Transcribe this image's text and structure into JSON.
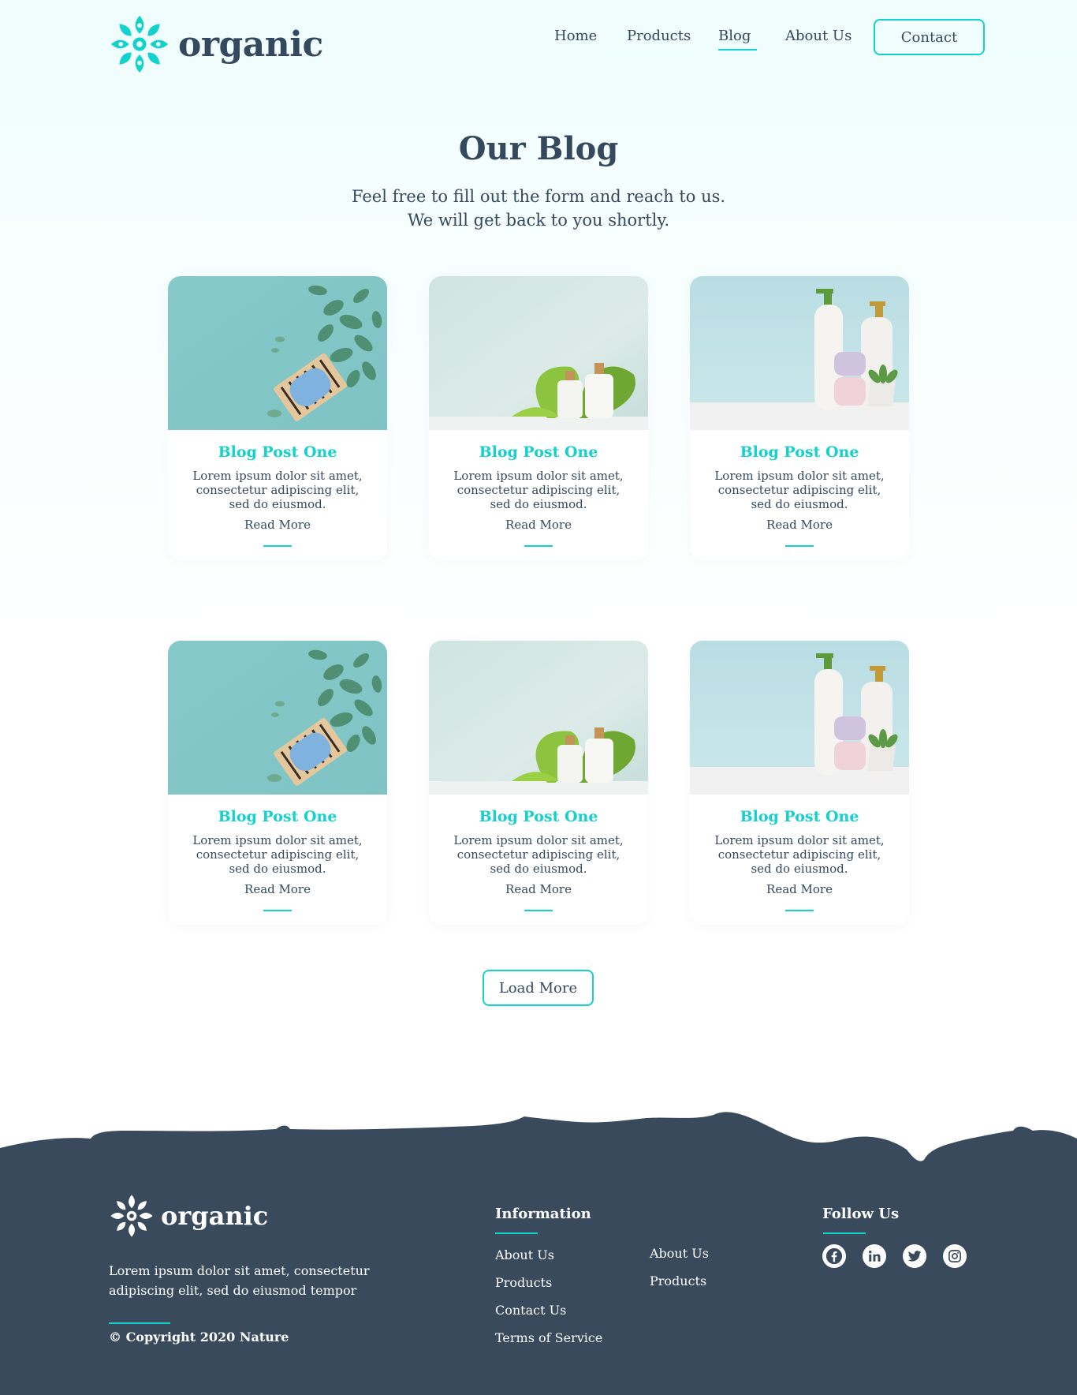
{
  "header": {
    "brand": "organic",
    "nav": [
      {
        "label": "Home",
        "active": false
      },
      {
        "label": "Products",
        "active": false
      },
      {
        "label": "Blog",
        "active": true
      },
      {
        "label": "About Us",
        "active": false
      }
    ],
    "contact_label": "Contact"
  },
  "hero": {
    "title": "Our Blog",
    "subtitle_line1": "Feel free to fill out the form and reach to us.",
    "subtitle_line2": "We will get back to you shortly."
  },
  "posts": [
    {
      "title": "Blog Post One",
      "excerpt": "Lorem ipsum dolor sit amet, consectetur adipiscing elit, sed do eiusmod.",
      "read_more": "Read More",
      "image": "eucalyptus-soap"
    },
    {
      "title": "Blog Post One",
      "excerpt": "Lorem ipsum dolor sit amet, consectetur adipiscing elit, sed do eiusmod.",
      "read_more": "Read More",
      "image": "leaf-bottles"
    },
    {
      "title": "Blog Post One",
      "excerpt": "Lorem ipsum dolor sit amet, consectetur adipiscing elit, sed do eiusmod.",
      "read_more": "Read More",
      "image": "pump-bottles"
    },
    {
      "title": "Blog Post One",
      "excerpt": "Lorem ipsum dolor sit amet, consectetur adipiscing elit, sed do eiusmod.",
      "read_more": "Read More",
      "image": "eucalyptus-soap"
    },
    {
      "title": "Blog Post One",
      "excerpt": "Lorem ipsum dolor sit amet, consectetur adipiscing elit, sed do eiusmod.",
      "read_more": "Read More",
      "image": "leaf-bottles"
    },
    {
      "title": "Blog Post One",
      "excerpt": "Lorem ipsum dolor sit amet, consectetur adipiscing elit, sed do eiusmod.",
      "read_more": "Read More",
      "image": "pump-bottles"
    }
  ],
  "load_more_label": "Load More",
  "footer": {
    "brand": "organic",
    "description": "Lorem ipsum dolor sit amet, consectetur adipiscing elit, sed do eiusmod tempor",
    "copyright": "© Copyright 2020 Nature",
    "information_heading": "Information",
    "links_col1": [
      "About Us",
      "Products",
      "Contact Us",
      "Terms of Service"
    ],
    "links_col2": [
      "About Us",
      "Products"
    ],
    "follow_heading": "Follow Us",
    "socials": [
      "facebook-icon",
      "linkedin-icon",
      "twitter-icon",
      "instagram-icon"
    ]
  },
  "colors": {
    "accent": "#12d2cb",
    "text": "#34495e",
    "footer_bg": "#384a5c"
  }
}
